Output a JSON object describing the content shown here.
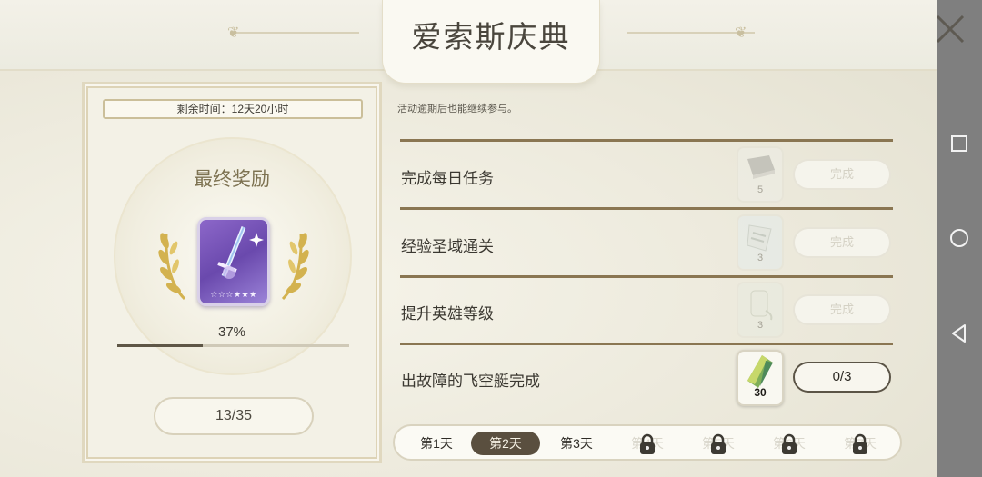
{
  "header": {
    "title": "爱索斯庆典",
    "close_icon": "close-icon"
  },
  "reward_panel": {
    "time_remaining": "剩余时间：12天20小时",
    "final_reward_label": "最终奖励",
    "progress_percent_text": "37%",
    "progress_fraction": 0.37,
    "count_text": "13/35",
    "card_stars": "☆☆☆★★★"
  },
  "tasks": {
    "note": "活动逾期后也能继续参与。",
    "items": [
      {
        "label": "完成每日任务",
        "reward_qty": "5",
        "status": "完成"
      },
      {
        "label": "经验圣域通关",
        "reward_qty": "3",
        "status": "完成"
      },
      {
        "label": "提升英雄等级",
        "reward_qty": "3",
        "status": "完成"
      },
      {
        "label": "出故障的飞空艇完成",
        "reward_qty": "30",
        "status": "0/3"
      }
    ]
  },
  "day_tabs": {
    "days": [
      {
        "label": "第1天",
        "state": "normal"
      },
      {
        "label": "第2天",
        "state": "selected"
      },
      {
        "label": "第3天",
        "state": "normal"
      },
      {
        "label": "第4天",
        "state": "locked"
      },
      {
        "label": "第5天",
        "state": "locked"
      },
      {
        "label": "第6天",
        "state": "locked"
      },
      {
        "label": "第7天",
        "state": "locked"
      }
    ]
  },
  "navbar": {
    "items": [
      "recent-apps-icon",
      "home-icon",
      "back-icon"
    ]
  },
  "colors": {
    "accent_brown": "#5a4f3f",
    "divider": "#8a7652",
    "card_purple": "#7a5bbd",
    "laurel_gold": "#d3b24f"
  }
}
